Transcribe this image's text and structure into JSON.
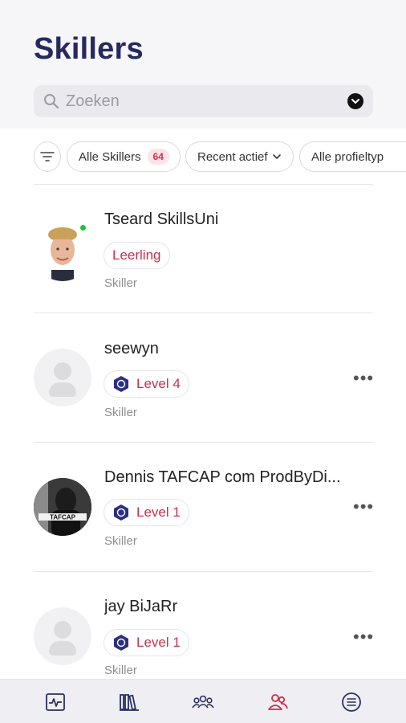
{
  "header": {
    "title": "Skillers"
  },
  "search": {
    "placeholder": "Zoeken"
  },
  "filters": {
    "all_label": "Alle Skillers",
    "all_count": "64",
    "recent_label": "Recent actief",
    "profile_label": "Alle profieltyp"
  },
  "colors": {
    "title": "#262a5e",
    "accent": "#c9304c",
    "online": "#1fc33c",
    "level_icon": "#2b3080"
  },
  "skillers": [
    {
      "name": "Tseard SkillsUni",
      "badge": "Leerling",
      "role": "Skiller",
      "online": true,
      "avatar": "photo"
    },
    {
      "name": "seewyn",
      "badge": "Level 4",
      "role": "Skiller",
      "avatar": "placeholder"
    },
    {
      "name": "Dennis TAFCAP com ProdByDi...",
      "badge": "Level 1",
      "role": "Skiller",
      "avatar": "photo",
      "avatar_text": "TAFCAP"
    },
    {
      "name": "jay BiJaRr",
      "badge": "Level 1",
      "role": "Skiller",
      "avatar": "placeholder"
    }
  ],
  "bottom_nav": [
    {
      "icon": "activity-icon"
    },
    {
      "icon": "library-icon"
    },
    {
      "icon": "groups-icon"
    },
    {
      "icon": "skillers-icon",
      "active": true
    },
    {
      "icon": "menu-list-icon"
    }
  ]
}
